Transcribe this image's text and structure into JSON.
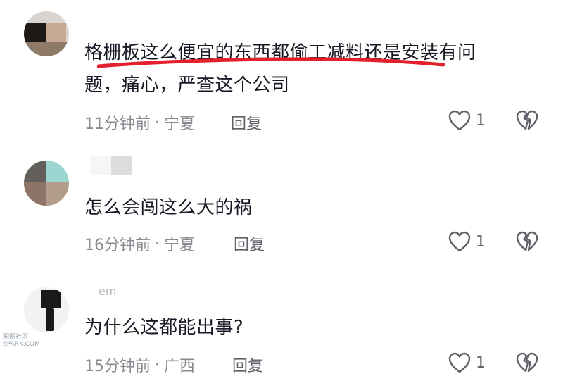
{
  "comments": [
    {
      "text_line1": "格栅板这么便宜的东西都偷工减料还是安装有问",
      "text_line2": "题，痛心，严查这个公司",
      "time": "11分钟前",
      "location": "宁夏",
      "reply_label": "回复",
      "likes": "1"
    },
    {
      "text": "怎么会闯这么大的祸",
      "time": "16分钟前",
      "location": "宁夏",
      "reply_label": "回复",
      "likes": "1"
    },
    {
      "username": "em",
      "text": "为什么这都能出事?",
      "time": "15分钟前",
      "location": "广西",
      "reply_label": "回复",
      "likes": "1"
    }
  ],
  "meta_separator": "·",
  "watermark": {
    "line1": "图图社区",
    "line2": "6PARK.COM"
  },
  "colors": {
    "underline": "#e4202c",
    "meta": "#8a8b91",
    "text": "#161823"
  },
  "icons": {
    "like": "heart-outline-icon",
    "dislike": "broken-heart-icon"
  }
}
